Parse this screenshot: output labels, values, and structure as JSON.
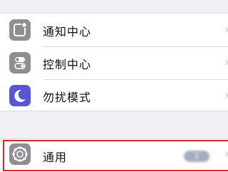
{
  "settings": {
    "groups": [
      {
        "items": [
          {
            "label": "通知中心",
            "icon": "notification-center-icon",
            "color": "#8e8e93"
          },
          {
            "label": "控制中心",
            "icon": "control-center-icon",
            "color": "#8e8e93"
          },
          {
            "label": "勿扰模式",
            "icon": "do-not-disturb-moon-icon",
            "color": "#5856d6"
          }
        ]
      },
      {
        "items": [
          {
            "label": "通用",
            "icon": "general-gear-icon",
            "color": "#8e8e93",
            "badge": "1"
          }
        ]
      }
    ],
    "chevron": "›",
    "highlight_color": "#d9262c"
  }
}
